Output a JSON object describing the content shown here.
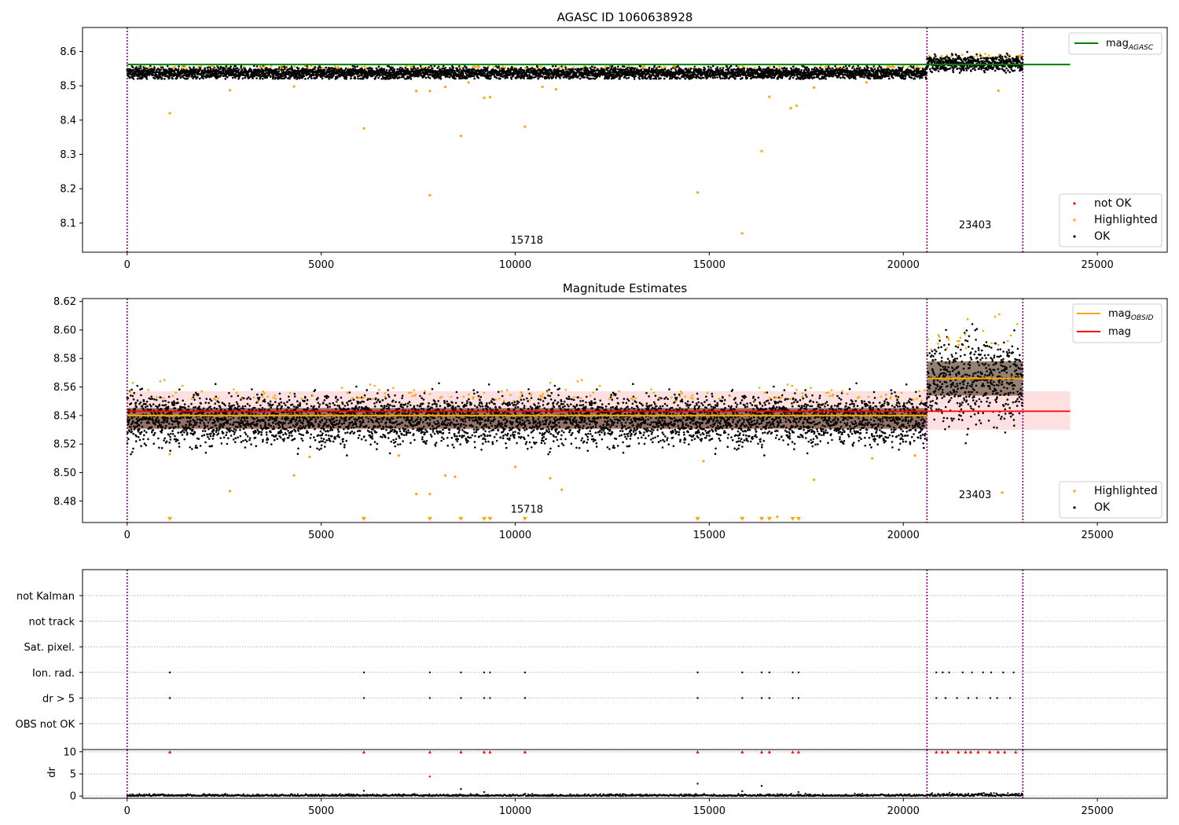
{
  "chart_data": [
    {
      "type": "scatter",
      "title": "AGASC ID 1060638928",
      "xlim": [
        -1150,
        26800
      ],
      "ylim": [
        8.015,
        8.67
      ],
      "xticks": [
        0,
        5000,
        10000,
        15000,
        20000,
        25000
      ],
      "yticks": [
        8.1,
        8.2,
        8.3,
        8.4,
        8.5,
        8.6
      ],
      "ytick_decimals": 1,
      "grid": false,
      "vlines": [
        0,
        20610,
        23080
      ],
      "obsid_labels": [
        {
          "text": "15718",
          "x": 10300,
          "y": 8.04
        },
        {
          "text": "23403",
          "x": 21850,
          "y": 8.085
        }
      ],
      "series": [
        {
          "name": "not OK",
          "color": "#ff0000",
          "role": "scatter"
        },
        {
          "name": "Highlighted",
          "color": "#ffa500",
          "role": "scatter"
        },
        {
          "name": "OK",
          "color": "#000000",
          "role": "scatter"
        },
        {
          "name": "mag_AGASC",
          "display": "mag",
          "sub": "AGASC",
          "color": "#008000",
          "role": "hline",
          "y": 8.562,
          "x": [
            0,
            24300
          ]
        }
      ],
      "bands": [
        {
          "x": [
            0,
            20610
          ],
          "center": 8.538,
          "spread": 0.009,
          "range": [
            8.52,
            8.558
          ]
        },
        {
          "x": [
            20610,
            23080
          ],
          "center": 8.567,
          "spread": 0.012,
          "range": [
            8.53,
            8.605
          ]
        }
      ],
      "outliers": [
        [
          1100,
          8.42
        ],
        [
          2650,
          8.487
        ],
        [
          4300,
          8.498
        ],
        [
          6100,
          8.376
        ],
        [
          7450,
          8.485
        ],
        [
          7800,
          8.181
        ],
        [
          7800,
          8.485
        ],
        [
          8200,
          8.497
        ],
        [
          8600,
          8.354
        ],
        [
          8800,
          8.51
        ],
        [
          9200,
          8.465
        ],
        [
          9350,
          8.467
        ],
        [
          10250,
          8.381
        ],
        [
          10700,
          8.497
        ],
        [
          11050,
          8.49
        ],
        [
          14700,
          8.189
        ],
        [
          15850,
          8.07
        ],
        [
          16350,
          8.31
        ],
        [
          16550,
          8.468
        ],
        [
          17100,
          8.435
        ],
        [
          17250,
          8.442
        ],
        [
          17700,
          8.495
        ],
        [
          19050,
          8.51
        ],
        [
          22450,
          8.486
        ]
      ],
      "legends": [
        {
          "position": "top-right",
          "entries": [
            "mag_AGASC"
          ]
        },
        {
          "position": "bottom-right",
          "entries": [
            "not OK",
            "Highlighted",
            "OK"
          ]
        }
      ]
    },
    {
      "type": "scatter",
      "title": "Magnitude Estimates",
      "xlim": [
        -1150,
        26800
      ],
      "ylim": [
        8.465,
        8.622
      ],
      "xticks": [
        0,
        5000,
        10000,
        15000,
        20000,
        25000
      ],
      "yticks": [
        8.48,
        8.5,
        8.52,
        8.54,
        8.56,
        8.58,
        8.6,
        8.62
      ],
      "ytick_decimals": 2,
      "grid": false,
      "vlines": [
        0,
        20610,
        23080
      ],
      "obsid_labels": [
        {
          "text": "15718",
          "x": 10300,
          "y": 8.472
        },
        {
          "text": "23403",
          "x": 21850,
          "y": 8.482
        }
      ],
      "series": [
        {
          "name": "Highlighted",
          "color": "#ffa500",
          "role": "scatter"
        },
        {
          "name": "OK",
          "color": "#000000",
          "role": "scatter"
        },
        {
          "name": "mag_OBSID",
          "display": "mag",
          "sub": "OBSID",
          "color": "#ffa500",
          "role": "step",
          "segments": [
            {
              "x": [
                0,
                20610
              ],
              "y": 8.54
            },
            {
              "x": [
                20610,
                23080
              ],
              "y": 8.566
            }
          ]
        },
        {
          "name": "mag",
          "display": "mag",
          "color": "#ff0000",
          "role": "hline",
          "y": 8.543,
          "x": [
            0,
            24300
          ],
          "band": {
            "low": 8.53,
            "high": 8.557,
            "color": "#ff0000",
            "opacity": 0.12
          }
        }
      ],
      "bands": [
        {
          "x": [
            0,
            20610
          ],
          "center": 8.538,
          "spread": 0.009,
          "range": [
            8.512,
            8.566
          ]
        },
        {
          "x": [
            20610,
            23080
          ],
          "center": 8.566,
          "spread": 0.015,
          "range": [
            8.52,
            8.612
          ]
        }
      ],
      "outliers": [
        [
          1100,
          8.513
        ],
        [
          2650,
          8.487
        ],
        [
          4300,
          8.498
        ],
        [
          4700,
          8.511
        ],
        [
          7000,
          8.512
        ],
        [
          7450,
          8.485
        ],
        [
          7800,
          8.485
        ],
        [
          8200,
          8.498
        ],
        [
          8450,
          8.497
        ],
        [
          10000,
          8.504
        ],
        [
          10900,
          8.496
        ],
        [
          11200,
          8.488
        ],
        [
          14850,
          8.508
        ],
        [
          16750,
          8.469
        ],
        [
          17700,
          8.495
        ],
        [
          19200,
          8.51
        ],
        [
          20300,
          8.512
        ],
        [
          22550,
          8.486
        ]
      ],
      "clipped_x": [
        1100,
        6100,
        7800,
        8600,
        9200,
        9350,
        10250,
        14700,
        15850,
        16350,
        16550,
        17150,
        17300
      ],
      "legends": [
        {
          "position": "top-right",
          "entries": [
            "mag_OBSID",
            "mag"
          ]
        },
        {
          "position": "bottom-right",
          "entries": [
            "Highlighted",
            "OK"
          ]
        }
      ]
    },
    {
      "type": "scatter",
      "title": "",
      "xlim": [
        -1150,
        26800
      ],
      "categories": [
        "not Kalman",
        "not track",
        "Sat. pixel.",
        "Ion. rad.",
        "dr > 5",
        "OBS not OK"
      ],
      "grid": true,
      "vlines": [
        0,
        20610,
        23080
      ],
      "flag_points": {
        "Ion. rad.": [
          1100,
          6100,
          7800,
          8600,
          9200,
          9350,
          10250,
          14700,
          15850,
          16350,
          16550,
          17150,
          17300
        ],
        "dr > 5": [
          1100,
          6100,
          7800,
          8600,
          9200,
          9350,
          10250,
          14700,
          15850,
          16350,
          16550,
          17150,
          17300
        ]
      },
      "flag_dense_range": [
        20850,
        23050
      ]
    },
    {
      "type": "scatter",
      "title": "",
      "xlim": [
        -1150,
        26800
      ],
      "ylim": [
        -0.5,
        10.5
      ],
      "ylabel": "dr",
      "xticks": [
        0,
        5000,
        10000,
        15000,
        20000,
        25000
      ],
      "yticks": [
        0,
        5,
        10
      ],
      "grid": true,
      "vlines": [
        0,
        20610,
        23080
      ],
      "clip_value": 10,
      "clipped_x": [
        1100,
        6100,
        7800,
        8600,
        9200,
        9350,
        10250,
        14700,
        15850,
        16350,
        16550,
        17150,
        17300
      ],
      "clipped_dense_range": [
        20850,
        23050
      ],
      "extra_points": [
        [
          6100,
          1.2
        ],
        [
          7800,
          4.4
        ],
        [
          8600,
          1.6
        ],
        [
          9200,
          0.9
        ],
        [
          14700,
          2.8
        ],
        [
          15850,
          1.1
        ],
        [
          16350,
          2.3
        ],
        [
          17300,
          0.9
        ]
      ]
    }
  ]
}
